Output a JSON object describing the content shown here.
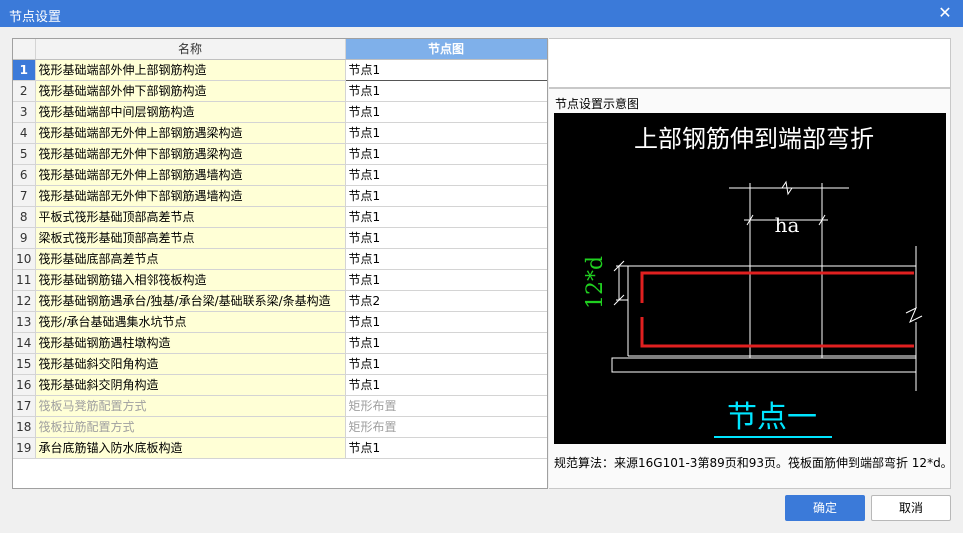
{
  "window": {
    "title": "节点设置",
    "close_glyph": "✕"
  },
  "table": {
    "headers": {
      "name": "名称",
      "node": "节点图"
    },
    "rows": [
      {
        "num": "1",
        "name": "筏形基础端部外伸上部钢筋构造",
        "value": "节点1",
        "selected": true,
        "disabled": false
      },
      {
        "num": "2",
        "name": "筏形基础端部外伸下部钢筋构造",
        "value": "节点1",
        "selected": false,
        "disabled": false
      },
      {
        "num": "3",
        "name": "筏形基础端部中间层钢筋构造",
        "value": "节点1",
        "selected": false,
        "disabled": false
      },
      {
        "num": "4",
        "name": "筏形基础端部无外伸上部钢筋遇梁构造",
        "value": "节点1",
        "selected": false,
        "disabled": false
      },
      {
        "num": "5",
        "name": "筏形基础端部无外伸下部钢筋遇梁构造",
        "value": "节点1",
        "selected": false,
        "disabled": false
      },
      {
        "num": "6",
        "name": "筏形基础端部无外伸上部钢筋遇墙构造",
        "value": "节点1",
        "selected": false,
        "disabled": false
      },
      {
        "num": "7",
        "name": "筏形基础端部无外伸下部钢筋遇墙构造",
        "value": "节点1",
        "selected": false,
        "disabled": false
      },
      {
        "num": "8",
        "name": "平板式筏形基础顶部高差节点",
        "value": "节点1",
        "selected": false,
        "disabled": false
      },
      {
        "num": "9",
        "name": "梁板式筏形基础顶部高差节点",
        "value": "节点1",
        "selected": false,
        "disabled": false
      },
      {
        "num": "10",
        "name": "筏形基础底部高差节点",
        "value": "节点1",
        "selected": false,
        "disabled": false
      },
      {
        "num": "11",
        "name": "筏形基础钢筋锚入相邻筏板构造",
        "value": "节点1",
        "selected": false,
        "disabled": false
      },
      {
        "num": "12",
        "name": "筏形基础钢筋遇承台/独基/承台梁/基础联系梁/条基构造",
        "value": "节点2",
        "selected": false,
        "disabled": false
      },
      {
        "num": "13",
        "name": "筏形/承台基础遇集水坑节点",
        "value": "节点1",
        "selected": false,
        "disabled": false
      },
      {
        "num": "14",
        "name": "筏形基础钢筋遇柱墩构造",
        "value": "节点1",
        "selected": false,
        "disabled": false
      },
      {
        "num": "15",
        "name": "筏形基础斜交阳角构造",
        "value": "节点1",
        "selected": false,
        "disabled": false
      },
      {
        "num": "16",
        "name": "筏形基础斜交阴角构造",
        "value": "节点1",
        "selected": false,
        "disabled": false
      },
      {
        "num": "17",
        "name": "筏板马凳筋配置方式",
        "value": "矩形布置",
        "selected": false,
        "disabled": true
      },
      {
        "num": "18",
        "name": "筏板拉筋配置方式",
        "value": "矩形布置",
        "selected": false,
        "disabled": true
      },
      {
        "num": "19",
        "name": "承台底筋锚入防水底板构造",
        "value": "节点1",
        "selected": false,
        "disabled": false
      }
    ]
  },
  "preview": {
    "label": "节点设置示意图",
    "diagram_title": "上部钢筋伸到端部弯折",
    "dim_ha": "ha",
    "dim_12d": "12*d",
    "node_caption": "节点一",
    "description": "规范算法：来源16G101-3第89页和93页。筏板面筋伸到端部弯折 12*d。",
    "colors": {
      "title": "#ffffff",
      "rebar": "#e02020",
      "dim_green": "#20d020",
      "caption": "#00e5ff"
    }
  },
  "buttons": {
    "ok": "确定",
    "cancel": "取消"
  }
}
